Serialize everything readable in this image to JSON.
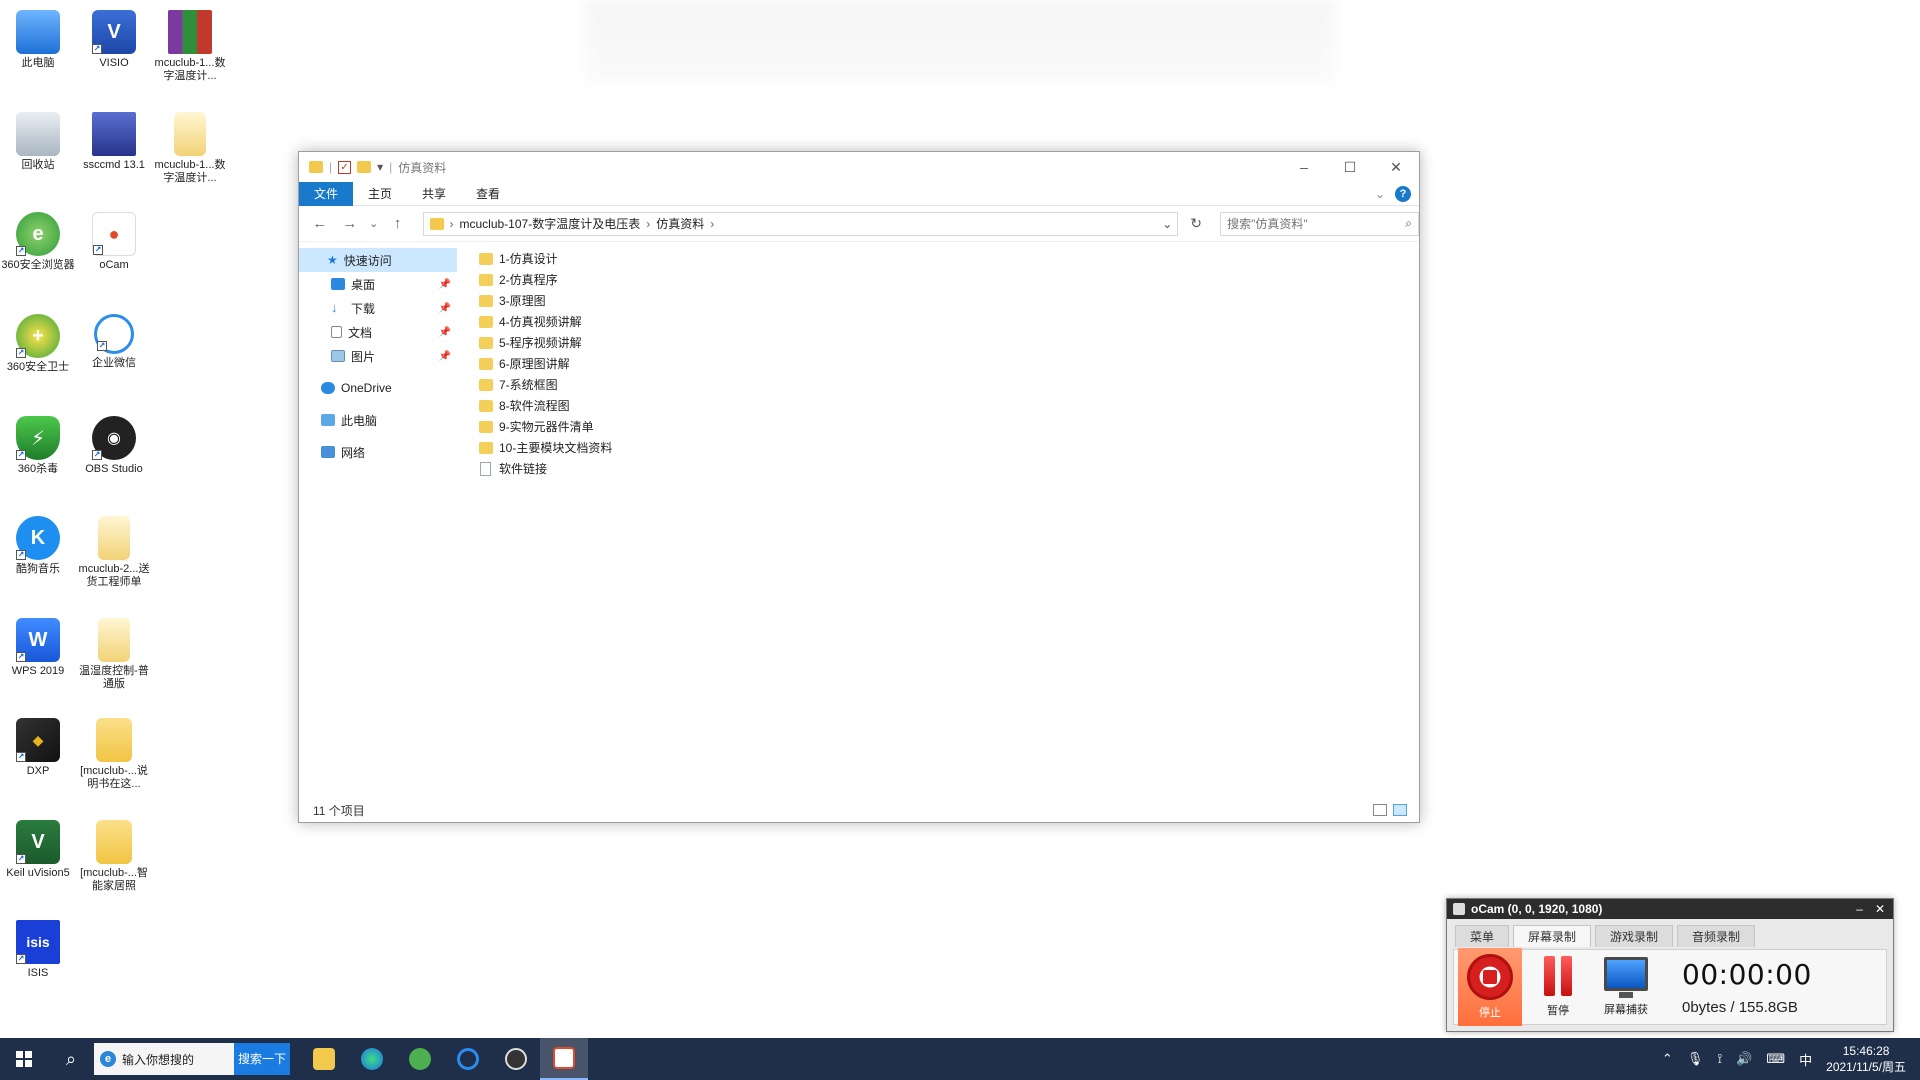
{
  "desktop": {
    "icons": [
      {
        "label": "此电脑"
      },
      {
        "label": "VISIO"
      },
      {
        "label": "mcuclub-1...数字温度计..."
      },
      {
        "label": "回收站"
      },
      {
        "label": "ssccmd 13.1"
      },
      {
        "label": "mcuclub-1...数字温度计..."
      },
      {
        "label": "360安全浏览器"
      },
      {
        "label": "oCam"
      },
      {
        "label": "360安全卫士"
      },
      {
        "label": "企业微信"
      },
      {
        "label": "360杀毒"
      },
      {
        "label": "OBS Studio"
      },
      {
        "label": "酷狗音乐"
      },
      {
        "label": "mcuclub-2...送货工程师单"
      },
      {
        "label": "WPS 2019"
      },
      {
        "label": "温湿度控制-普通版"
      },
      {
        "label": "DXP"
      },
      {
        "label": "[mcuclub-...说明书在这..."
      },
      {
        "label": "Keil uVision5"
      },
      {
        "label": "[mcuclub-...智能家居照"
      },
      {
        "label": "ISIS"
      }
    ]
  },
  "explorer": {
    "title": "仿真资料",
    "ribbon_tabs": [
      "文件",
      "主页",
      "共享",
      "查看"
    ],
    "nav": {
      "back": "←",
      "forward": "→",
      "recent": "⌄",
      "up": "↑"
    },
    "breadcrumb": [
      "mcuclub-107-数字温度计及电压表",
      "仿真资料"
    ],
    "search_placeholder": "搜索\"仿真资料\"",
    "nav_pane": [
      {
        "label": "快速访问"
      },
      {
        "label": "桌面"
      },
      {
        "label": "下载"
      },
      {
        "label": "文档"
      },
      {
        "label": "图片"
      },
      {
        "label": "OneDrive"
      },
      {
        "label": "此电脑"
      },
      {
        "label": "网络"
      }
    ],
    "files": [
      {
        "name": "1-仿真设计",
        "type": "folder"
      },
      {
        "name": "2-仿真程序",
        "type": "folder"
      },
      {
        "name": "3-原理图",
        "type": "folder"
      },
      {
        "name": "4-仿真视频讲解",
        "type": "folder"
      },
      {
        "name": "5-程序视频讲解",
        "type": "folder"
      },
      {
        "name": "6-原理图讲解",
        "type": "folder"
      },
      {
        "name": "7-系统框图",
        "type": "folder"
      },
      {
        "name": "8-软件流程图",
        "type": "folder"
      },
      {
        "name": "9-实物元器件清单",
        "type": "folder"
      },
      {
        "name": "10-主要模块文档资料",
        "type": "folder"
      },
      {
        "name": "软件链接",
        "type": "file"
      }
    ],
    "status": "11 个项目"
  },
  "ocam": {
    "title": "oCam (0, 0, 1920, 1080)",
    "tabs": [
      "菜单",
      "屏幕录制",
      "游戏录制",
      "音频录制"
    ],
    "active_tab": "屏幕录制",
    "tools": {
      "stop": "停止",
      "pause": "暂停",
      "capture": "屏幕捕获"
    },
    "time": "00:00:00",
    "size": "0bytes / 155.8GB"
  },
  "taskbar": {
    "search_placeholder": "输入你想搜的",
    "search_button": "搜索一下",
    "ime": "中",
    "time": "15:46:28",
    "date": "2021/11/5/周五"
  },
  "colors": {
    "accent": "#1979ca",
    "taskbar": "#1f2f4a",
    "folder": "#f4cf5a"
  }
}
